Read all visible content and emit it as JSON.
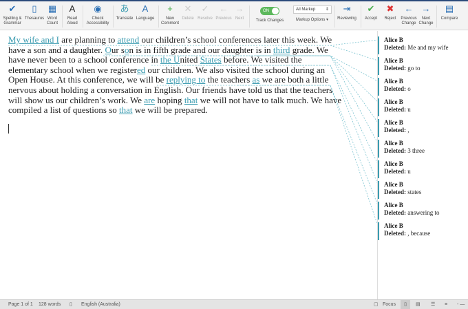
{
  "ribbon": {
    "spelling": "Spelling & Grammar",
    "thesaurus": "Thesaurus",
    "word_count": "Word Count",
    "read_aloud": "Read Aloud",
    "accessibility": "Check Accessibility",
    "translate": "Translate",
    "language": "Language",
    "new_comment": "New Comment",
    "delete": "Delete",
    "resolve": "Resolve",
    "previous": "Previous",
    "next": "Next",
    "track_changes": "Track Changes",
    "toggle": "ON",
    "markup_select": "All Markup",
    "markup_options": "Markup Options",
    "reviewing": "Reviewing",
    "accept": "Accept",
    "reject": "Reject",
    "previous_change": "Previous Change",
    "next_change": "Next Change",
    "compare": "Compare"
  },
  "document": {
    "lines": [
      [
        {
          "t": "My wife and I",
          "ins": true
        },
        {
          "t": " are planning to "
        },
        {
          "t": "attend",
          "ins": true
        },
        {
          "t": " our children’s school conferences later this week. We"
        }
      ],
      [
        {
          "t": "have a son and a daughter. "
        },
        {
          "t": "O",
          "ins": true
        },
        {
          "t": "ur s"
        },
        {
          "t": "o",
          "ins": true
        },
        {
          "t": "n is in fifth grade and our daughter is in "
        },
        {
          "t": "third",
          "ins": true
        },
        {
          "t": " grade. We"
        }
      ],
      [
        {
          "t": "have never been to a school conference in "
        },
        {
          "t": "the U",
          "ins": true
        },
        {
          "t": "nited "
        },
        {
          "t": "States",
          "ins": true
        },
        {
          "t": " before. We visited the"
        }
      ],
      [
        {
          "t": "elementary school when we register"
        },
        {
          "t": "ed",
          "ins": true
        },
        {
          "t": " our children. We also visited the school during an"
        }
      ],
      [
        {
          "t": "Open House. At this conference, we will be "
        },
        {
          "t": "replying to",
          "ins": true
        },
        {
          "t": " the teachers "
        },
        {
          "t": "as",
          "ins": true
        },
        {
          "t": " we are both a little"
        }
      ],
      [
        {
          "t": "nervous about holding a conversation in English. Our friends have told us that the teachers"
        }
      ],
      [
        {
          "t": "will show us our children’s work. We "
        },
        {
          "t": "are",
          "ins": true
        },
        {
          "t": " hoping "
        },
        {
          "t": "that",
          "ins": true
        },
        {
          "t": " we will not have to talk much. We have"
        }
      ],
      [
        {
          "t": "compiled a list of questions so "
        },
        {
          "t": "that",
          "ins": true
        },
        {
          "t": " we will be prepared."
        }
      ]
    ]
  },
  "comments": [
    {
      "author": "Alice B",
      "label": "Deleted:",
      "text": "Me and my wife"
    },
    {
      "author": "Alice B",
      "label": "Deleted:",
      "text": "go to"
    },
    {
      "author": "Alice B",
      "label": "Deleted:",
      "text": " o"
    },
    {
      "author": "Alice B",
      "label": "Deleted:",
      "text": "u"
    },
    {
      "author": "Alice B",
      "label": "Deleted:",
      "text": ","
    },
    {
      "author": "Alice B",
      "label": "Deleted:",
      "text": " 3 three"
    },
    {
      "author": "Alice B",
      "label": "Deleted:",
      "text": "u"
    },
    {
      "author": "Alice B",
      "label": "Deleted:",
      "text": "states"
    },
    {
      "author": "Alice B",
      "label": "Deleted:",
      "text": "answering to"
    },
    {
      "author": "Alice B",
      "label": "Deleted:",
      "text": ", because"
    }
  ],
  "status": {
    "page": "Page 1 of 1",
    "words": "128 words",
    "language": "English (Australia)",
    "focus": "Focus"
  },
  "colors": {
    "insert": "#3a9bb0"
  }
}
